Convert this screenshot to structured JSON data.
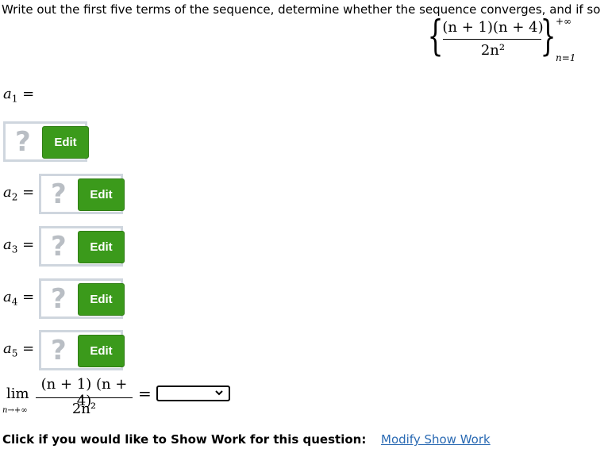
{
  "question": {
    "prompt": "Write out the first five terms of the sequence, determine whether the sequence converges, and if so"
  },
  "sequence": {
    "numerator": "(n + 1)(n + 4)",
    "denominator": "2n²",
    "upper": "+∞",
    "lower": "n=1"
  },
  "terms": [
    {
      "var": "a",
      "index": "1",
      "eq": "="
    },
    {
      "var": "a",
      "index": "2",
      "eq": "="
    },
    {
      "var": "a",
      "index": "3",
      "eq": "="
    },
    {
      "var": "a",
      "index": "4",
      "eq": "="
    },
    {
      "var": "a",
      "index": "5",
      "eq": "="
    }
  ],
  "widget": {
    "placeholder": "?",
    "edit_label": "Edit"
  },
  "limit": {
    "lim": "lim",
    "sub": "n→+∞",
    "numerator": "(n + 1) (n + 4)",
    "denominator": "2n²",
    "eq": "=",
    "selected": ""
  },
  "footer": {
    "prompt": "Click if you would like to Show Work for this question:",
    "link": "Modify Show Work"
  },
  "colors": {
    "edit_green": "#3b9a1b",
    "widget_border": "#cfd6de",
    "link_blue": "#2a6ab3"
  }
}
